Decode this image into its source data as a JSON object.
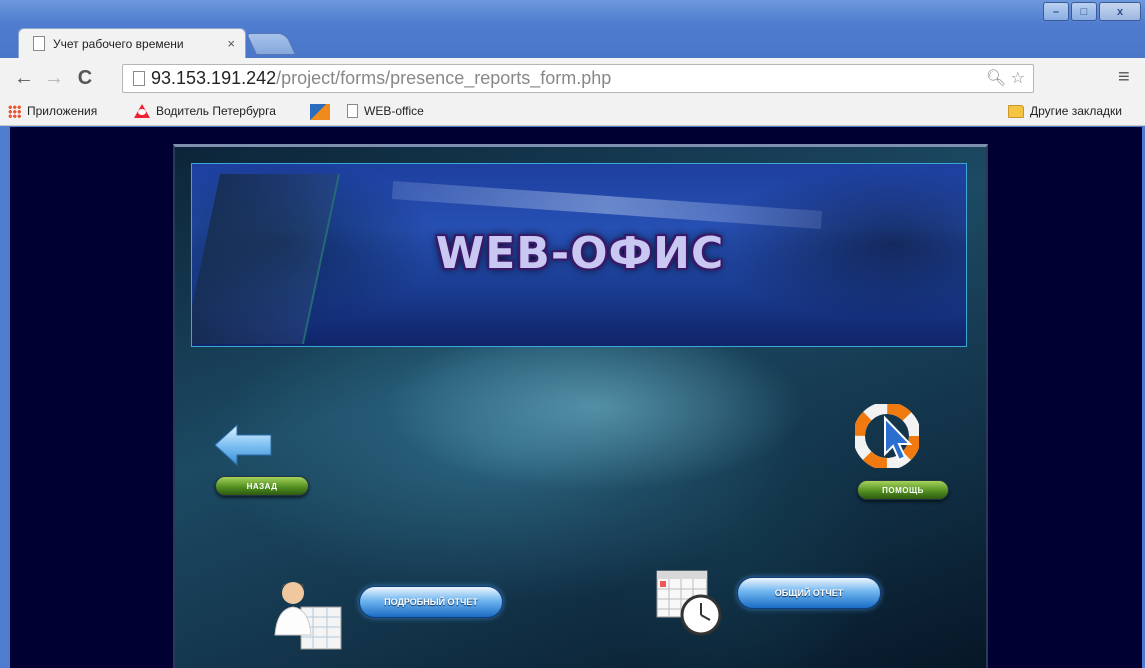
{
  "browser": {
    "tab_title": "Учет рабочего времени",
    "tab_close": "×",
    "url_host": "93.153.191.242",
    "url_path": "/project/forms/presence_reports_form.php",
    "window_controls": [
      "–",
      "□",
      "x"
    ]
  },
  "bookmarks": {
    "apps": "Приложения",
    "item1": "Водитель Петербурга",
    "item3": "WEB-office",
    "other": "Другие закладки"
  },
  "page": {
    "banner_title": "WEB-ОФИС",
    "back_label": "НАЗАД",
    "help_label": "ПОМОЩЬ",
    "detailed_report_label": "ПОДРОБНЫЙ ОТЧЕТ",
    "general_report_label": "ОБЩИЙ ОТЧЕТ"
  },
  "colors": {
    "page_bg": "#000033",
    "banner_text": "#c9c8f2",
    "pill_green": "#4d8a1e",
    "pill_blue": "#1b6cc4"
  }
}
